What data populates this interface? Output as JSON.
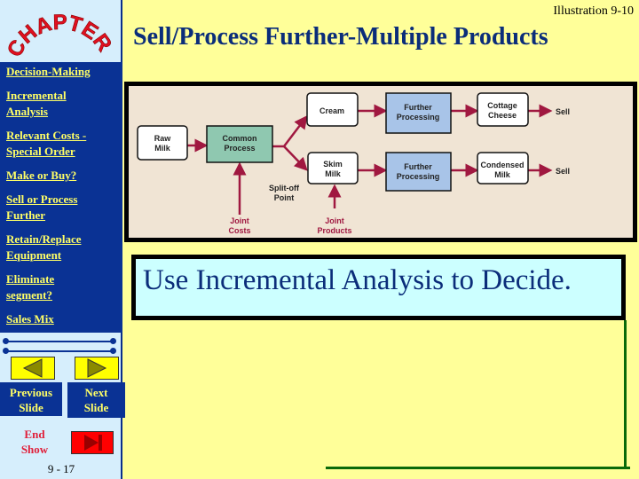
{
  "header": {
    "illustration": "Illustration 9-10",
    "title": "Sell/Process Further-Multiple Products"
  },
  "logo": {
    "text": "CHAPTER"
  },
  "sidebar": {
    "items": [
      {
        "label": "Decision-Making"
      },
      {
        "label": "Incremental\nAnalysis"
      },
      {
        "label": "Relevant Costs -\nSpecial Order"
      },
      {
        "label": "Make or Buy?"
      },
      {
        "label": "Sell or Process\nFurther"
      },
      {
        "label": "Retain/Replace\nEquipment"
      },
      {
        "label": "Eliminate      \nsegment?"
      },
      {
        "label": "Sales Mix"
      }
    ],
    "previous": "Previous\nSlide",
    "next": "Next\nSlide",
    "end": "End\nShow",
    "page": "9 - 17"
  },
  "diagram": {
    "raw_milk": "Raw",
    "raw_milk2": "Milk",
    "common": "Common",
    "common2": "Process",
    "cream": "Cream",
    "skim": "Skim",
    "skim2": "Milk",
    "further": "Further",
    "further2": "Processing",
    "cottage": "Cottage",
    "cottage2": "Cheese",
    "condensed": "Condensed",
    "condensed2": "Milk",
    "sell": "Sell",
    "splitoff": "Split-off",
    "splitoff2": "Point",
    "joint_costs": "Joint",
    "joint_costs2": "Costs",
    "joint_products": "Joint",
    "joint_products2": "Products",
    "colors": {
      "common": "#8fc8b0",
      "further": "#a8c4e8",
      "arrow": "#a01840",
      "label": "#a01840"
    }
  },
  "main": {
    "text": "Use Incremental Analysis to Decide."
  }
}
